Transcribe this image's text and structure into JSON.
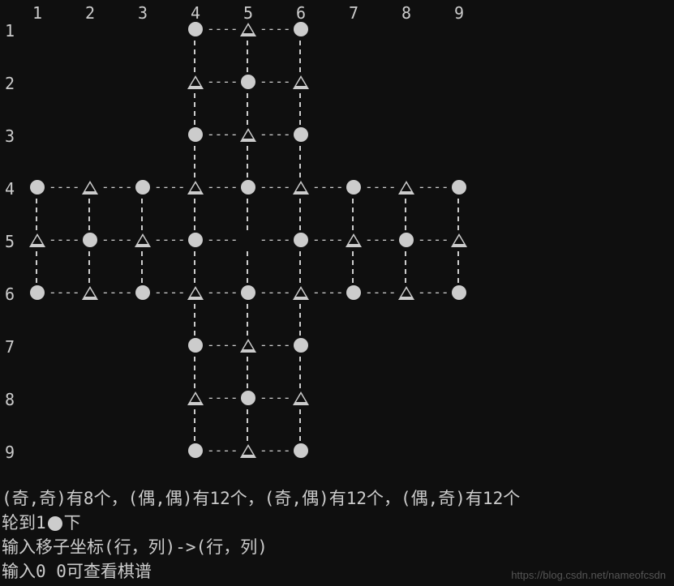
{
  "grid": {
    "cols": [
      "1",
      "2",
      "3",
      "4",
      "5",
      "6",
      "7",
      "8",
      "9"
    ],
    "rows": [
      "1",
      "2",
      "3",
      "4",
      "5",
      "6",
      "7",
      "8",
      "9"
    ]
  },
  "board": [
    [
      null,
      null,
      null,
      "O",
      "T",
      "O",
      null,
      null,
      null
    ],
    [
      null,
      null,
      null,
      "T",
      "O",
      "T",
      null,
      null,
      null
    ],
    [
      null,
      null,
      null,
      "O",
      "T",
      "O",
      null,
      null,
      null
    ],
    [
      "O",
      "T",
      "O",
      "T",
      "O",
      "T",
      "O",
      "T",
      "O"
    ],
    [
      "T",
      "O",
      "T",
      "O",
      null,
      "O",
      "T",
      "O",
      "T"
    ],
    [
      "O",
      "T",
      "O",
      "T",
      "O",
      "T",
      "O",
      "T",
      "O"
    ],
    [
      null,
      null,
      null,
      "O",
      "T",
      "O",
      null,
      null,
      null
    ],
    [
      null,
      null,
      null,
      "T",
      "O",
      "T",
      null,
      null,
      null
    ],
    [
      null,
      null,
      null,
      "O",
      "T",
      "O",
      null,
      null,
      null
    ]
  ],
  "region": [
    [
      0,
      0,
      0,
      1,
      1,
      1,
      0,
      0,
      0
    ],
    [
      0,
      0,
      0,
      1,
      1,
      1,
      0,
      0,
      0
    ],
    [
      0,
      0,
      0,
      1,
      1,
      1,
      0,
      0,
      0
    ],
    [
      1,
      1,
      1,
      1,
      1,
      1,
      1,
      1,
      1
    ],
    [
      1,
      1,
      1,
      1,
      1,
      1,
      1,
      1,
      1
    ],
    [
      1,
      1,
      1,
      1,
      1,
      1,
      1,
      1,
      1
    ],
    [
      0,
      0,
      0,
      1,
      1,
      1,
      0,
      0,
      0
    ],
    [
      0,
      0,
      0,
      1,
      1,
      1,
      0,
      0,
      0
    ],
    [
      0,
      0,
      0,
      1,
      1,
      1,
      0,
      0,
      0
    ]
  ],
  "status": {
    "line1": "(奇,奇)有8个，(偶,偶)有12个，(奇,偶)有12个，(偶,奇)有12个",
    "line2_prefix": "轮到1",
    "line2_suffix": "下",
    "line3": "输入移子坐标(行，列)->(行，列)",
    "line4": "输入0 0可查看棋谱"
  },
  "watermark": "https://blog.csdn.net/nameofcsdn",
  "chart_data": {
    "type": "table",
    "title": "Cross-shaped game board 9x9",
    "piece_legend": {
      "O": "circle",
      "T": "triangle",
      "null": "empty"
    },
    "counts": {
      "奇奇": 8,
      "偶偶": 12,
      "奇偶": 12,
      "偶奇": 12
    },
    "turn": {
      "player": 1,
      "piece": "circle"
    },
    "center_empty": [
      5,
      5
    ]
  }
}
